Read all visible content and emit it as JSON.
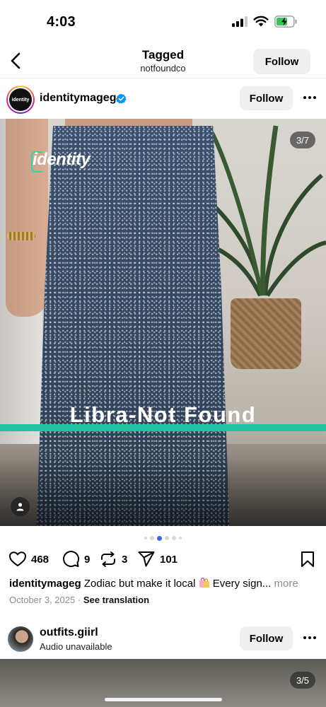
{
  "status_bar": {
    "time": "4:03",
    "icons": [
      "cellular-signal-icon",
      "wifi-icon",
      "battery-charging-icon"
    ]
  },
  "header": {
    "title": "Tagged",
    "subtitle": "notfoundco",
    "follow_label": "Follow",
    "back_icon": "chevron-left-icon"
  },
  "post": {
    "username": "identitymageg",
    "verified": true,
    "avatar_text": "identity",
    "follow_label": "Follow",
    "media": {
      "counter": "3/7",
      "watermark": "identity",
      "overlay_text": "Libra-Not Found",
      "accent_color": "#22c3a3"
    },
    "carousel": {
      "count": 7,
      "active_index": 2
    },
    "actions": {
      "likes": "468",
      "comments": "9",
      "reposts": "3",
      "shares": "101"
    },
    "caption": {
      "username": "identitymageg",
      "text_before": "Zodiac but make it local",
      "text_after": "Every sign...",
      "more": "more"
    },
    "date": "October 3, 2025",
    "separator": "·",
    "see_translation": "See translation"
  },
  "next_post": {
    "username": "outfits.giirl",
    "subtitle": "Audio unavailable",
    "follow_label": "Follow",
    "counter": "3/5"
  },
  "colors": {
    "button_bg": "#efeff2",
    "verified_blue": "#0095f6",
    "active_dot": "#3e6ad8"
  }
}
